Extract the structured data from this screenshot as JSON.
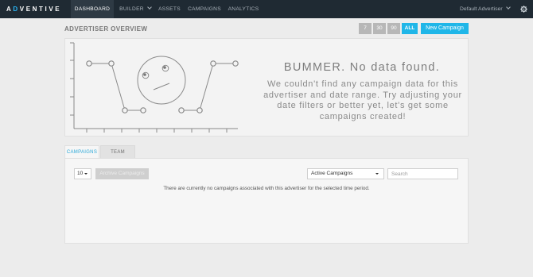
{
  "brand": {
    "logo_prefix": "A",
    "logo_accent": "D",
    "logo_suffix": "VENTIVE",
    "accent_color": "#1fb6e8",
    "nav_bg": "#1f2a33"
  },
  "nav": {
    "items": [
      {
        "label": "DASHBOARD",
        "active": true
      },
      {
        "label": "BUILDER",
        "has_dropdown": true
      },
      {
        "label": "ASSETS"
      },
      {
        "label": "CAMPAIGNS"
      },
      {
        "label": "ANALYTICS"
      }
    ],
    "advertiser_label": "Default Advertiser",
    "settings_icon": "gear-icon"
  },
  "overview": {
    "title": "ADVERTISER OVERVIEW",
    "ranges": [
      "7",
      "30",
      "90",
      "ALL"
    ],
    "active_range": "ALL",
    "new_campaign_label": "New Campaign",
    "nodata_title": "BUMMER. No data found.",
    "nodata_message": "We couldn't find any campaign data for this advertiser and date range. Try adjusting your date filters or better yet, let's get some campaigns created!"
  },
  "tabs": [
    {
      "label": "CAMPAIGNS",
      "active": true
    },
    {
      "label": "TEAM",
      "active": false
    }
  ],
  "campaigns": {
    "page_size": "10",
    "archive_label": "Archive Campaigns",
    "filter_value": "Active Campaigns",
    "search_placeholder": "Search",
    "empty_message": "There are currently no campaigns associated with this advertiser for the selected time period."
  }
}
